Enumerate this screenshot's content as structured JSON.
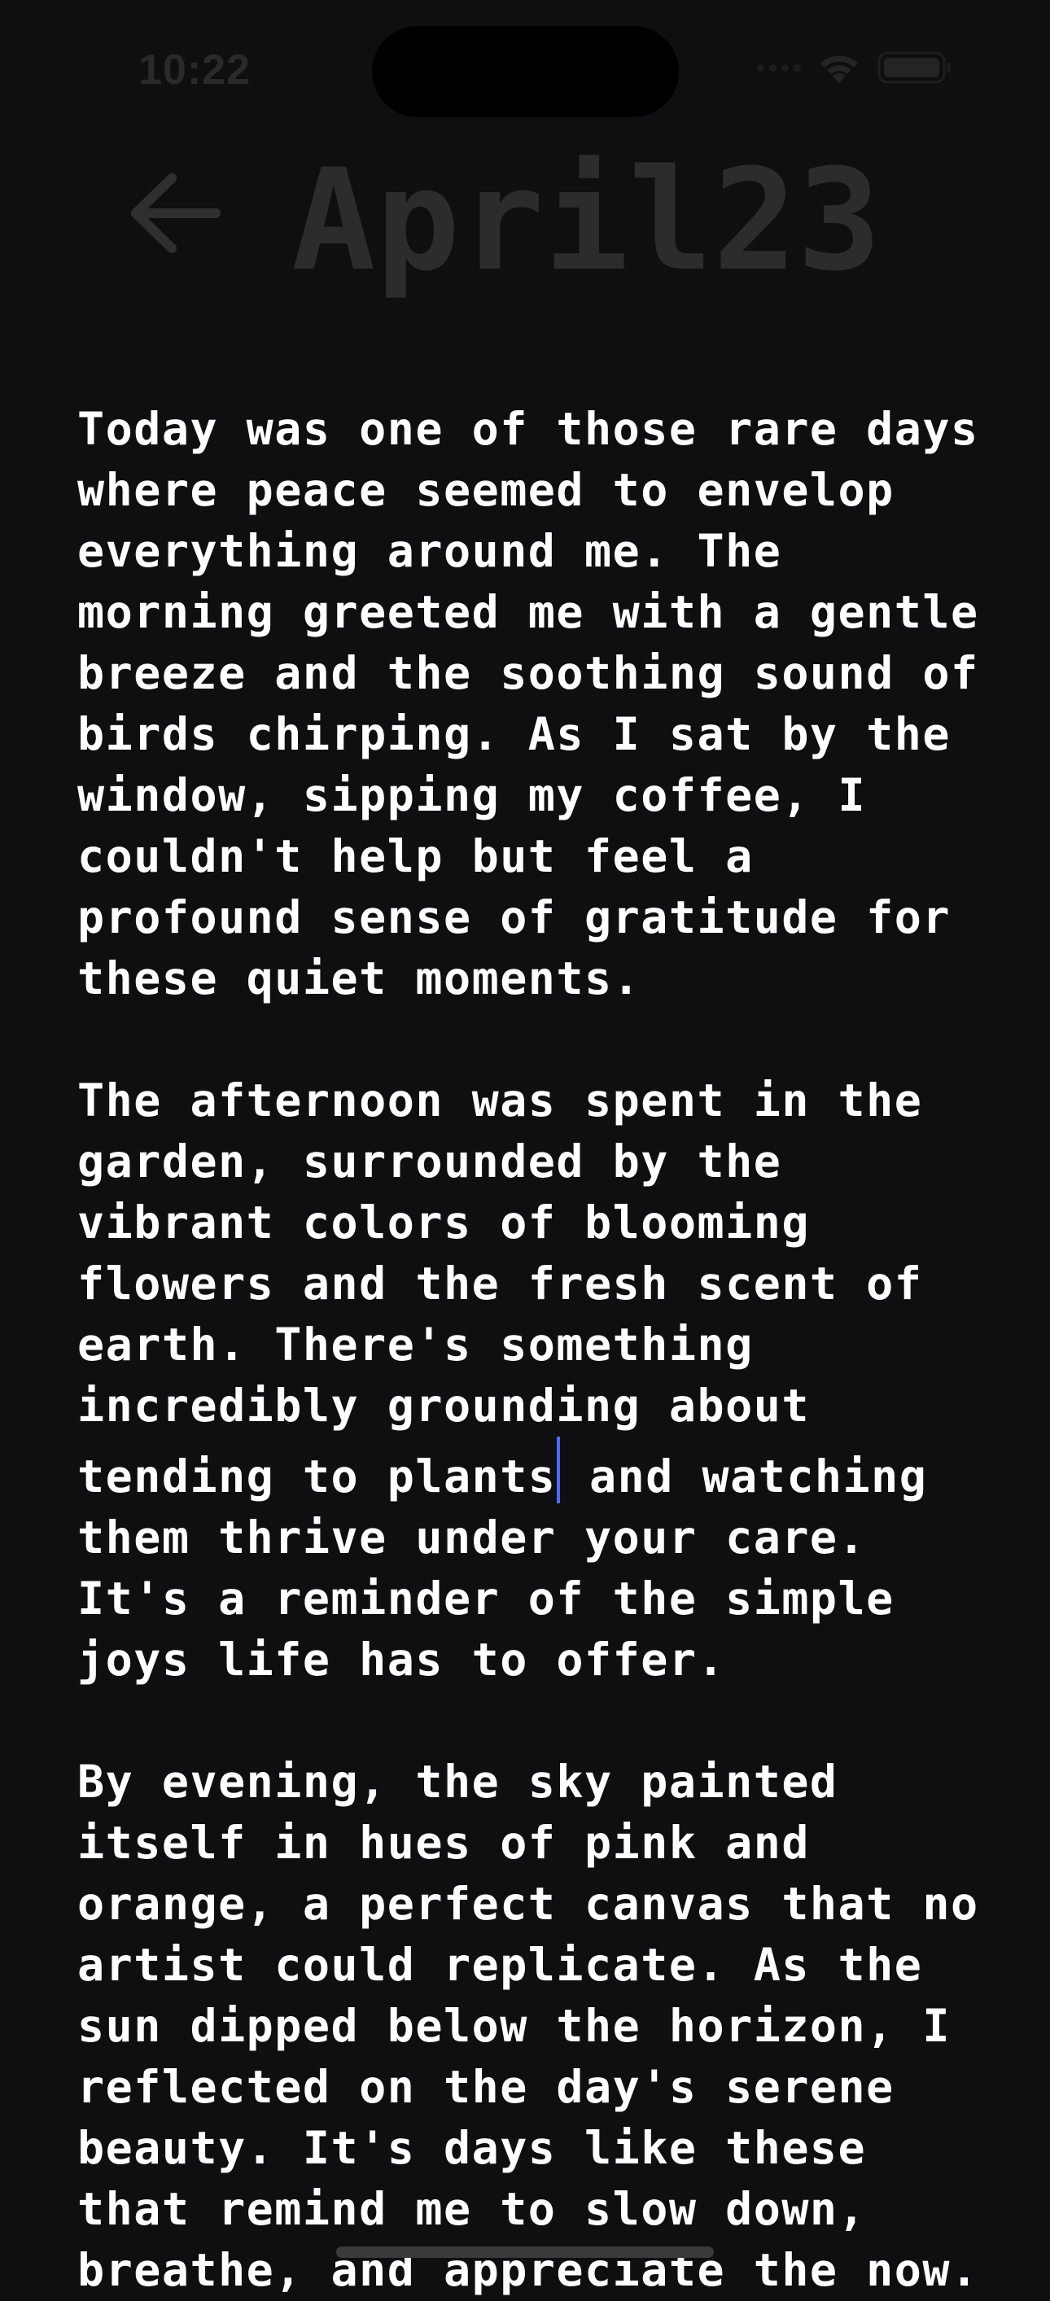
{
  "status_bar": {
    "time": "10:22",
    "icons": [
      "signal-icon",
      "wifi-icon",
      "battery-icon"
    ]
  },
  "header": {
    "title": "April23",
    "back_icon": "arrow-left-icon"
  },
  "entry": {
    "paragraph_1": "Today was one of those rare days\nwhere peace seemed to envelop\neverything around me. The\nmorning greeted me with a gentle\nbreeze and the soothing sound of\nbirds chirping. As I sat by the\nwindow, sipping my coffee, I\ncouldn't help but feel a\nprofound sense of gratitude for\nthese quiet moments.",
    "paragraph_2_before_cursor": "The afternoon was spent in the\ngarden, surrounded by the\nvibrant colors of blooming\nflowers and the fresh scent of\nearth. There's something\nincredibly grounding about\ntending to plants",
    "paragraph_2_after_cursor": " and watching\nthem thrive under your care.\nIt's a reminder of the simple\njoys life has to offer.",
    "paragraph_3": "By evening, the sky painted\nitself in hues of pink and\norange, a perfect canvas that no\nartist could replicate. As the\nsun dipped below the horizon, I\nreflected on the day's serene\nbeauty. It's days like these\nthat remind me to slow down,\nbreathe, and appreciate the now."
  },
  "colors": {
    "background": "#0f0f11",
    "text": "#ffffff",
    "title": "#2c2c2f",
    "cursor": "#4e6bf5"
  }
}
